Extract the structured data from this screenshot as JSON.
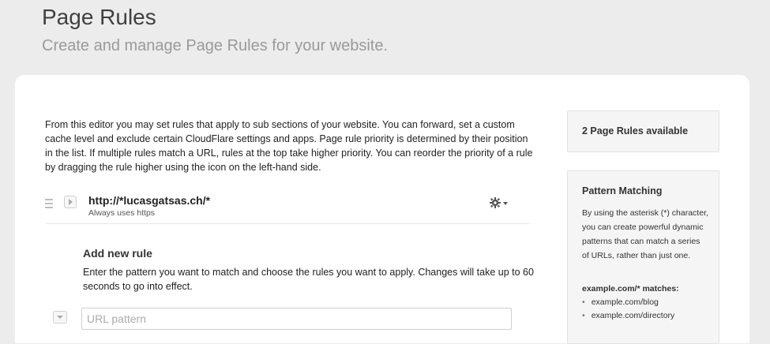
{
  "header": {
    "title": "Page Rules",
    "subtitle": "Create and manage Page Rules for your website."
  },
  "intro": {
    "text": "From this editor you may set rules that apply to sub sections of your website. You can forward, set a custom cache level and exclude certain CloudFlare settings and apps. Page rule priority is determined by their position in the list. If multiple rules match a URL, rules at the top take higher priority. You can reorder the priority of a rule by dragging the rule higher using the icon on the left-hand side."
  },
  "rules": [
    {
      "url": "http://*lucasgatsas.ch/*",
      "note": "Always uses https"
    }
  ],
  "add_rule": {
    "title": "Add new rule",
    "description": "Enter the pattern you want to match and choose the rules you want to apply. Changes will take up to 60 seconds to go into effect.",
    "url_placeholder": "URL pattern"
  },
  "sidebar": {
    "available": "2 Page Rules available",
    "help": {
      "title": "Pattern Matching",
      "body": "By using the asterisk (*) character, you can create powerful dynamic patterns that can match a series of URLs, rather than just one.",
      "example_heading": "example.com/* matches:",
      "examples": [
        "example.com/blog",
        "example.com/directory"
      ]
    }
  },
  "icons": {
    "drag": "drag-handle-icon",
    "expand": "expand-arrow-icon",
    "settings": "gear-icon"
  }
}
